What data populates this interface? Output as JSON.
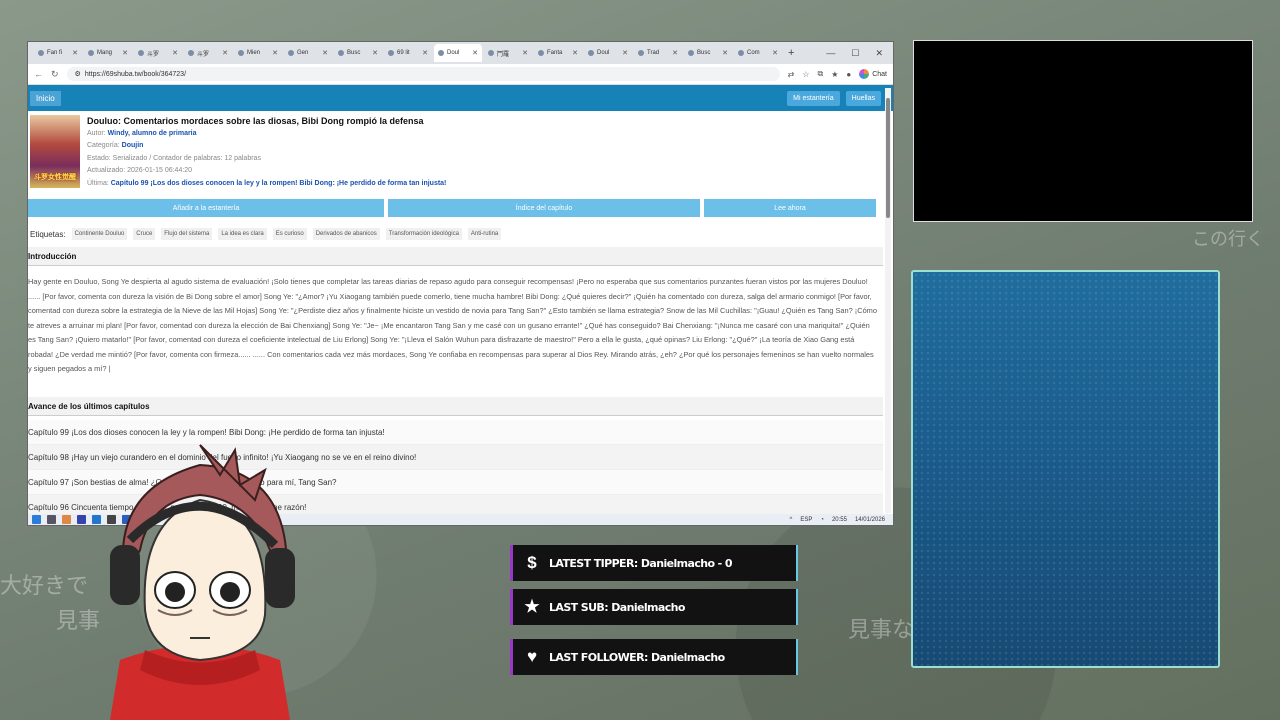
{
  "browser": {
    "tabs": [
      {
        "label": "Fan fi"
      },
      {
        "label": "Mang"
      },
      {
        "label": "斗罗"
      },
      {
        "label": "斗罗"
      },
      {
        "label": "Mien"
      },
      {
        "label": "Gen"
      },
      {
        "label": "Busc"
      },
      {
        "label": "69 lit"
      },
      {
        "label": "Doul",
        "active": true
      },
      {
        "label": "鬥羅"
      },
      {
        "label": "Fanta"
      },
      {
        "label": "Doul"
      },
      {
        "label": "Trad"
      },
      {
        "label": "Busc"
      },
      {
        "label": "Com"
      }
    ],
    "url": "https://69shuba.tw/book/364723/",
    "chat_label": "Chat"
  },
  "site": {
    "home": "Inicio",
    "bookshelf": "Mi estantería",
    "footprints": "Huellas"
  },
  "book": {
    "cover_text": "斗罗女性觉醒",
    "title": "Douluo: Comentarios mordaces sobre las diosas, Bibi Dong rompió la defensa",
    "author_label": "Autor:",
    "author": "Windy, alumno de primaria",
    "category_label": "Categoría:",
    "category": "Doujin",
    "status": "Estado: Serializado / Contador de palabras: 12 palabras",
    "updated": "Actualizado: 2026-01-15 06:44:20",
    "latest_label": "Última:",
    "latest": "Capítulo 99 ¡Los dos dioses conocen la ley y la rompen! Bibi Dong: ¡He perdido de forma tan injusta!"
  },
  "actions": {
    "add": "Añadir a la estantería",
    "index": "Índice del capítulo",
    "read": "Lee ahora"
  },
  "tags": {
    "label": "Etiquetas:",
    "items": [
      "Continente Douluo",
      "Cruce",
      "Flujo del sistema",
      "La idea es clara",
      "Es curioso",
      "Derivados de abanicos",
      "Transformación ideológica",
      "Anti-rutina"
    ]
  },
  "intro": {
    "heading": "Introducción",
    "text": "Hay gente en Douluo, Song Ye despierta al agudo sistema de evaluación! ¡Solo tienes que completar las tareas diarias de repaso agudo para conseguir recompensas! ¡Pero no esperaba que sus comentarios punzantes fueran vistos por las mujeres Douluo! ...... [Por favor, comenta con dureza la visión de Bi Dong sobre el amor] Song Ye: \"¿Amor? ¡Yu Xiaogang también puede comerlo, tiene mucha hambre! Bibi Dong: ¿Qué quieres decir?\" ¡Quién ha comentado con dureza, salga del armario conmigo! [Por favor, comentad con dureza sobre la estrategia de la Nieve de las Mil Hojas] Song Ye: \"¿Perdiste diez años y finalmente hiciste un vestido de novia para Tang San?\" ¿Esto también se llama estrategia? Snow de las Mil Cuchillas: \"¡Guau! ¿Quién es Tang San? ¡Cómo te atreves a arruinar mi plan! [Por favor, comentad con dureza la elección de Bai Chenxiang] Song Ye: \"Je~ ¡Me encantaron Tang San y me casé con un gusano errante!\" ¿Qué has conseguido? Bai Chenxiang: \"¡Nunca me casaré con una mariquita!\" ¿Quién es Tang San? ¡Quiero matarlo!\" [Por favor, comentad con dureza el coeficiente intelectual de Liu Erlong] Song Ye: \"¡Lleva el Salón Wuhun para disfrazarte de maestro!\" Pero a ella le gusta, ¿qué opinas? Liu Erlong: \"¿Qué?\" ¡La teoría de Xiao Gang está robada! ¿De verdad me mintió? [Por favor, comenta con firmeza...... ...... Con comentarios cada vez más mordaces, Song Ye confiaba en recompensas para superar al Dios Rey. Mirando atrás, ¿eh? ¿Por qué los personajes femeninos se han vuelto normales y siguen pegados a mí? |"
  },
  "chapters": {
    "heading": "Avance de los últimos capítulos",
    "items": [
      "Capítulo 99 ¡Los dos dioses conocen la ley y la rompen! Bibi Dong: ¡He perdido de forma tan injusta!",
      "Capítulo 98 ¡Hay un viejo curandero en el dominio del fuego infinito! ¡Yu Xiaogang no se ve en el reino divino!",
      "Capítulo 97 ¡Son bestias de alma! ¿Qué tipo de alma es adecuado para mí, Tang San?",
      "Capítulo 96 Cincuenta tiempo después, padre! ¡Nivel 90, mi padre tiene razón!"
    ]
  },
  "taskbar": {
    "lang": "ESP",
    "time": "20:55",
    "date": "14/01/2026"
  },
  "stream": {
    "latest_tipper": "LATEST TIPPER: Danielmacho - 0",
    "last_sub": "LAST SUB: Danielmacho",
    "last_follower": "LAST FOLLOWER: Danielmacho",
    "bg_text_1": "大好きで",
    "bg_text_2": "見事",
    "bg_text_3": "見事な",
    "bg_text_4": "この行く"
  },
  "colors": {
    "nav_blue": "#1682b8",
    "button_blue": "#6bbfe8",
    "link_blue": "#1a52b0",
    "alert_purple": "#9a37c8",
    "alert_cyan": "#67c8e6"
  }
}
